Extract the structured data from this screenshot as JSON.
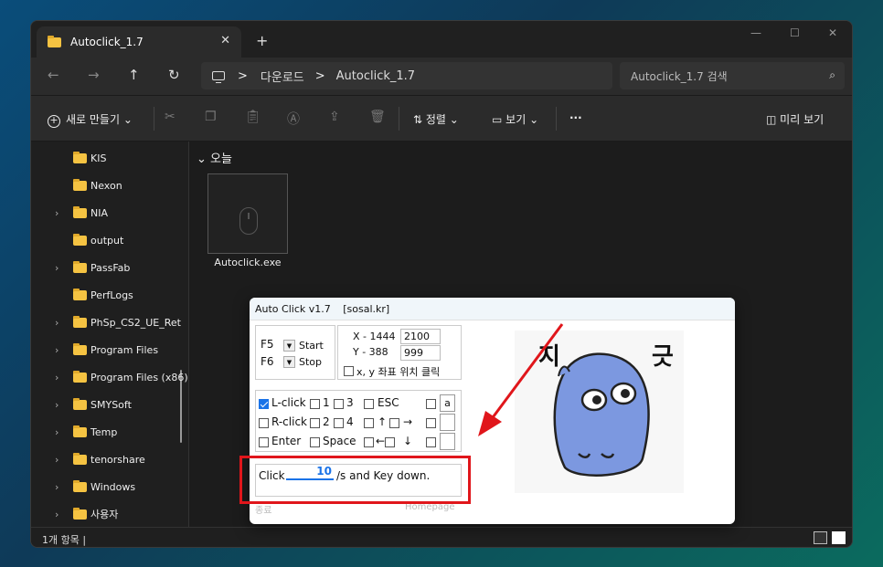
{
  "window": {
    "tab_title": "Autoclick_1.7",
    "tab_close": "✕",
    "tab_add": "+",
    "minimize": "—",
    "maximize": "☐",
    "close": "✕"
  },
  "nav": {
    "back": "←",
    "forward": "→",
    "up": "↑",
    "refresh": "↻",
    "breadcrumb": [
      "다운로드",
      "Autoclick_1.7"
    ],
    "separator": ">",
    "search_placeholder": "Autoclick_1.7 검색",
    "search_icon": "⌕"
  },
  "toolbar": {
    "new_label": "새로 만들기",
    "sort_label": "정렬",
    "view_label": "보기",
    "more_label": "···",
    "details_label": "미리 보기",
    "icons": [
      "cut-icon",
      "copy-icon",
      "paste-icon",
      "rename-icon",
      "share-icon",
      "delete-icon"
    ]
  },
  "sidebar": {
    "items": [
      {
        "label": "KIS",
        "expandable": false
      },
      {
        "label": "Nexon",
        "expandable": false
      },
      {
        "label": "NIA",
        "expandable": true
      },
      {
        "label": "output",
        "expandable": false
      },
      {
        "label": "PassFab",
        "expandable": true
      },
      {
        "label": "PerfLogs",
        "expandable": false
      },
      {
        "label": "PhSp_CS2_UE_Ret",
        "expandable": true
      },
      {
        "label": "Program Files",
        "expandable": true
      },
      {
        "label": "Program Files (x86)",
        "expandable": true
      },
      {
        "label": "SMYSoft",
        "expandable": true
      },
      {
        "label": "Temp",
        "expandable": true
      },
      {
        "label": "tenorshare",
        "expandable": true
      },
      {
        "label": "Windows",
        "expandable": true
      },
      {
        "label": "사용자",
        "expandable": true
      }
    ]
  },
  "content": {
    "group_label": "오늘",
    "file_name": "Autoclick.exe"
  },
  "status": {
    "item_count": "1개 항목",
    "separator": "|"
  },
  "autoclick": {
    "title": "Auto Click v1.7",
    "site": "[sosal.kr]",
    "f5": "F5",
    "f6": "F6",
    "start": "Start",
    "stop": "Stop",
    "x_label": "X - 1444",
    "y_label": "Y - 388",
    "x_value": "2100",
    "y_value": "999",
    "coord_check": "x, y 좌표 위치 클릭",
    "keys": {
      "lclick": "L-click",
      "rclick": "R-click",
      "enter": "Enter",
      "k1": "1",
      "k2": "2",
      "k3": "3",
      "k4": "4",
      "space": "Space",
      "esc": "ESC",
      "up": "↑",
      "right": "→",
      "left": "←",
      "down": "↓",
      "custom1": "a",
      "custom2": "",
      "custom3": ""
    },
    "click_label": "Click",
    "click_value": "10",
    "per_sec": "/s  and Key down.",
    "footer_left": "종료",
    "footer_right": "Homepage"
  },
  "sticker": {
    "text_left": "지",
    "text_right": "긋"
  },
  "annotation_color": "#e0161b",
  "accent_color": "#1a73e8"
}
